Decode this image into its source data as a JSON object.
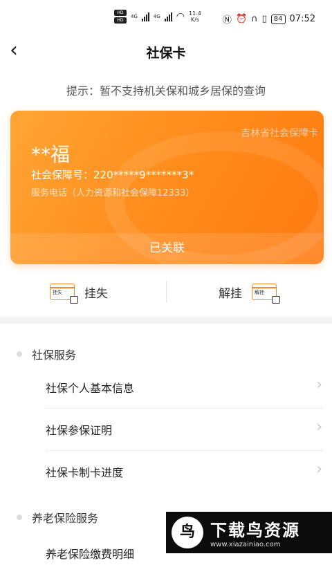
{
  "status_bar": {
    "hd_top": "HD",
    "hd_bottom": "HD",
    "net_type_1": "4G",
    "net_type_2": "4G",
    "speed_value": "11.4",
    "speed_unit": "K/s",
    "battery": "84",
    "time": "07:52"
  },
  "nav": {
    "back_icon": "chevron-left-icon",
    "title": "社保卡"
  },
  "hint": "提示：暂不支持机关保和城乡居保的查询",
  "card": {
    "org": "吉林省社会保障卡",
    "name": "**福",
    "number": "社会保障号：220*****9*******3*",
    "phone": "服务电话（人力资源和社会保障12333）",
    "status": "已关联",
    "accent": "#ff8a1a"
  },
  "actions": {
    "loss": {
      "label": "挂失",
      "icon_text": "挂失",
      "icon": "card-lock-icon"
    },
    "unloss": {
      "label": "解挂",
      "icon_text": "解挂",
      "icon": "card-unlock-icon"
    }
  },
  "sections": [
    {
      "title": "社保服务",
      "items": [
        "社保个人基本信息",
        "社保参保证明",
        "社保卡制卡进度"
      ]
    },
    {
      "title": "养老保险服务",
      "items": [
        "养老保险缴费明细"
      ]
    }
  ],
  "watermark": {
    "logo": "鸟",
    "text": "下载鸟资源",
    "url": "www.xiazainiao.com"
  }
}
